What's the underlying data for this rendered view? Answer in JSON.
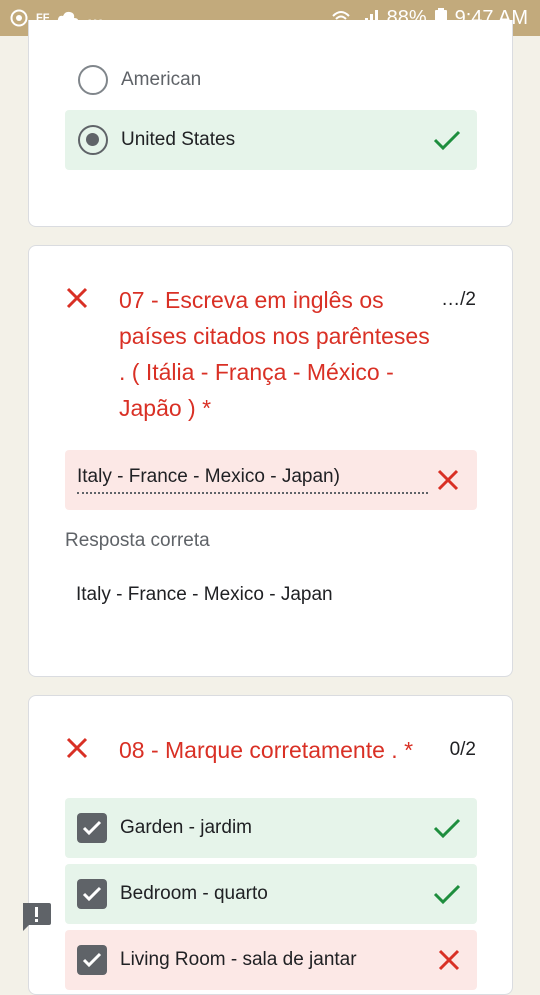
{
  "status_bar": {
    "carrier_label": "FF",
    "overflow": "...",
    "battery": "88%",
    "time": "9:47 AM"
  },
  "colors": {
    "status_bar_bg": "#c2aa7c",
    "correct_bg": "#e6f4ea",
    "wrong_bg": "#fce8e6",
    "error_red": "#d93025",
    "success_green": "#1e8e3e"
  },
  "question6": {
    "options": [
      {
        "label": "American",
        "selected": false,
        "result": "none"
      },
      {
        "label": "United States",
        "selected": true,
        "result": "correct"
      }
    ]
  },
  "question7": {
    "title": "07 - Escreva em inglês os países citados nos parênteses . ( Itália - França - México - Japão ) *",
    "score": "…/2",
    "answer": "Italy - France - Mexico - Japan)",
    "correct_label": "Resposta correta",
    "correct_answer": "Italy - France - Mexico - Japan"
  },
  "question8": {
    "title": "08 - Marque corretamente . *",
    "score": "0/2",
    "options": [
      {
        "label": "Garden - jardim",
        "checked": true,
        "result": "correct"
      },
      {
        "label": "Bedroom - quarto",
        "checked": true,
        "result": "correct"
      },
      {
        "label": "Living Room - sala de jantar",
        "checked": true,
        "result": "wrong"
      }
    ]
  },
  "icons": {
    "chrome": "chrome-icon",
    "cloud": "cloud-icon",
    "wifi": "wifi-icon",
    "signal": "signal-icon",
    "battery": "battery-icon",
    "feedback": "feedback-icon"
  }
}
